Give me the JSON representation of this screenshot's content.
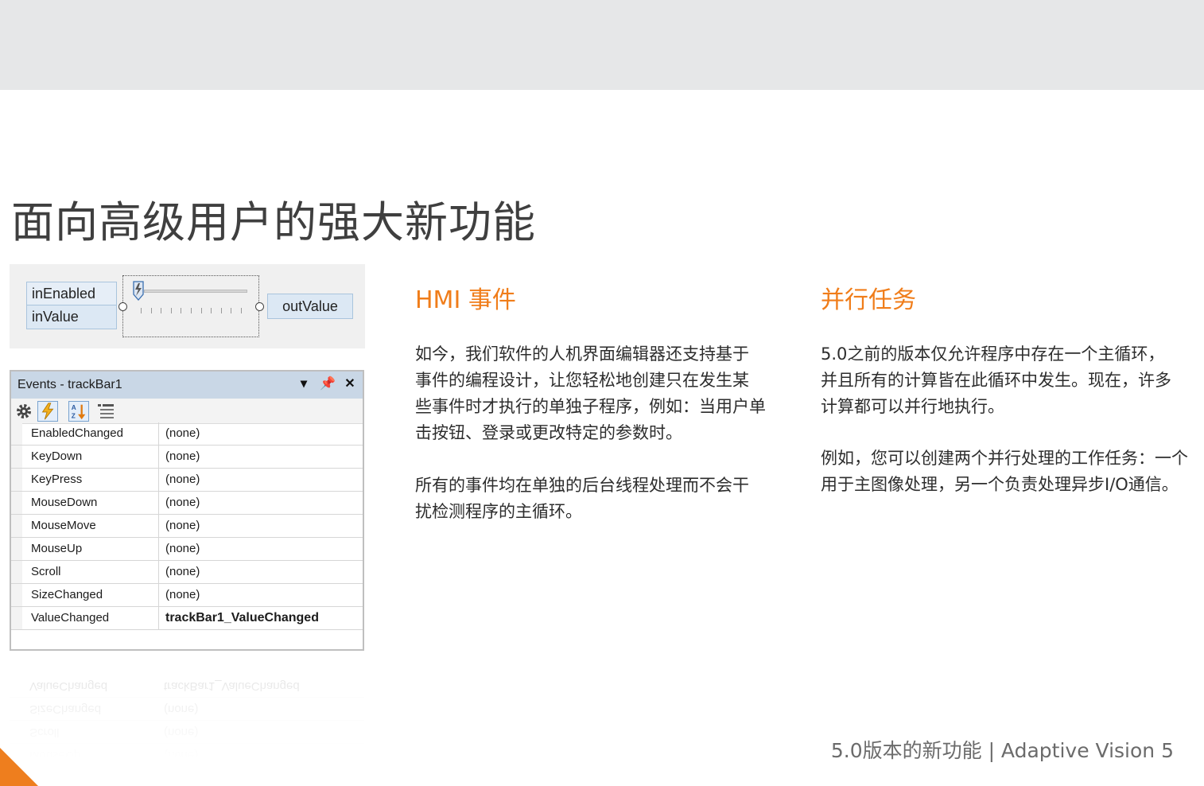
{
  "page": {
    "title": "面向高级用户的强大新功能",
    "footer": "5.0版本的新功能 | Adaptive Vision 5",
    "accent_color": "#f07d1a"
  },
  "node_widget": {
    "inputs": [
      "inEnabled",
      "inValue"
    ],
    "output": "outValue"
  },
  "events_panel": {
    "title": "Events - trackBar1",
    "toolbar_icons": [
      "gear-icon",
      "lightning-icon",
      "sort-alphabetical-icon",
      "categorized-list-icon"
    ],
    "title_buttons": [
      "dropdown-icon",
      "pin-icon",
      "close-icon"
    ],
    "rows": [
      {
        "name": "EnabledChanged",
        "value": "(none)"
      },
      {
        "name": "KeyDown",
        "value": "(none)"
      },
      {
        "name": "KeyPress",
        "value": "(none)"
      },
      {
        "name": "MouseDown",
        "value": "(none)"
      },
      {
        "name": "MouseMove",
        "value": "(none)"
      },
      {
        "name": "MouseUp",
        "value": "(none)"
      },
      {
        "name": "Scroll",
        "value": "(none)"
      },
      {
        "name": "SizeChanged",
        "value": "(none)"
      },
      {
        "name": "ValueChanged",
        "value": "trackBar1_ValueChanged"
      }
    ]
  },
  "hmi_section": {
    "heading": "HMI 事件",
    "paragraphs": [
      [
        "如今，我们软件的人机界面编辑器还支持基于",
        "事件的编程设计，让您轻松地创建只在发生某",
        "些事件时才执行的单独子程序，例如：当用户单",
        "击按钮、登录或更改特定的参数时。"
      ],
      [
        "所有的事件均在单独的后台线程处理而不会干",
        "扰检测程序的主循环。"
      ]
    ]
  },
  "parallel_section": {
    "heading": "并行任务",
    "paragraphs": [
      [
        "5.0之前的版本仅允许程序中存在一个主循环，",
        "并且所有的计算皆在此循环中发生。现在，许多",
        "计算都可以并行地执行。"
      ],
      [
        "例如，您可以创建两个并行处理的工作任务：一个",
        "用于主图像处理，另一个负责处理异步I/O通信。"
      ]
    ]
  }
}
